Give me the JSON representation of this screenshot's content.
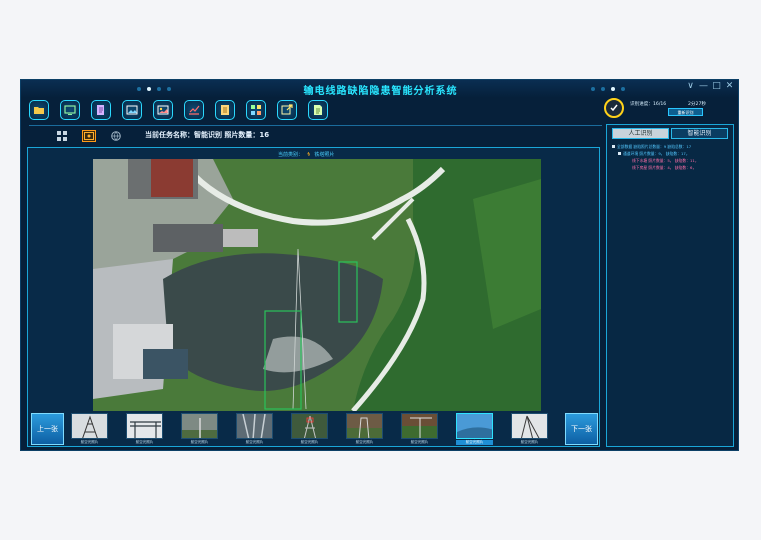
{
  "app": {
    "title": "输电线路缺陷隐患智能分析系统"
  },
  "window_controls": [
    "∨",
    "—",
    "□",
    "✕"
  ],
  "toolbar": {
    "tools": [
      {
        "name": "open-folder-icon"
      },
      {
        "name": "screen-icon"
      },
      {
        "name": "edit-icon"
      },
      {
        "name": "image-icon"
      },
      {
        "name": "gallery-icon"
      },
      {
        "name": "chart-icon"
      },
      {
        "name": "report-icon"
      },
      {
        "name": "grid-icon"
      },
      {
        "name": "export-icon"
      },
      {
        "name": "document-icon"
      }
    ]
  },
  "task": {
    "text": "当前任务名称：智能识别 照片数量：16"
  },
  "progress": {
    "label": "识别进度：16/16",
    "count": "2分27秒",
    "restart_label": "重新识别"
  },
  "current_category": {
    "label": "当前类别：",
    "value": "铁塔照片"
  },
  "nav": {
    "prev": "上一张",
    "next": "下一张"
  },
  "right_panel": {
    "tabs": [
      "人工识别",
      "智能识别"
    ],
    "tree": [
      "全部数据   缺陷照片总数量：9  缺陷总数：17",
      "通道环境  照片数量：9，  缺陷数：17，",
      "线下水塘  照片数量：5，  缺陷数：11，",
      "线下房屋  照片数量：4，  缺陷数：6，"
    ]
  },
  "thumbnails": [
    {
      "label": "航空光照片"
    },
    {
      "label": "航空光照片"
    },
    {
      "label": "航空光照片"
    },
    {
      "label": "航空光照片"
    },
    {
      "label": "航空光照片"
    },
    {
      "label": "航空光照片"
    },
    {
      "label": "航空光照片"
    },
    {
      "label": "航空光照片"
    },
    {
      "label": "航空光照片"
    }
  ],
  "colors": {
    "accent": "#29e6ff",
    "panel": "#06203a",
    "button": "#1f8fd6",
    "box": "#29c25a"
  }
}
